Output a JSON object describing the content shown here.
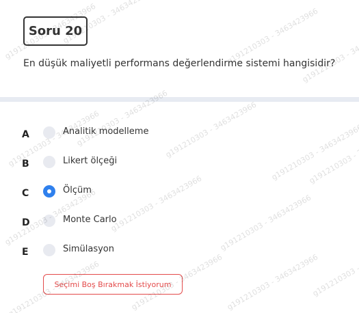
{
  "question": {
    "number_label": "Soru 20",
    "text": "En düşük maliyetli performans değerlendirme sistemi hangisidir?"
  },
  "options": [
    {
      "letter": "A",
      "label": "Analitik modelleme",
      "selected": false
    },
    {
      "letter": "B",
      "label": "Likert ölçeği",
      "selected": false
    },
    {
      "letter": "C",
      "label": "Ölçüm",
      "selected": true
    },
    {
      "letter": "D",
      "label": "Monte Carlo",
      "selected": false
    },
    {
      "letter": "E",
      "label": "Simülasyon",
      "selected": false
    }
  ],
  "blank_button_label": "Seçimi Boş Bırakmak İstiyorum",
  "watermark_text": "g191210303 - 3463423966",
  "colors": {
    "accent": "#2f80ed",
    "danger": "#e34a4a",
    "divider": "#e7ebf2"
  }
}
